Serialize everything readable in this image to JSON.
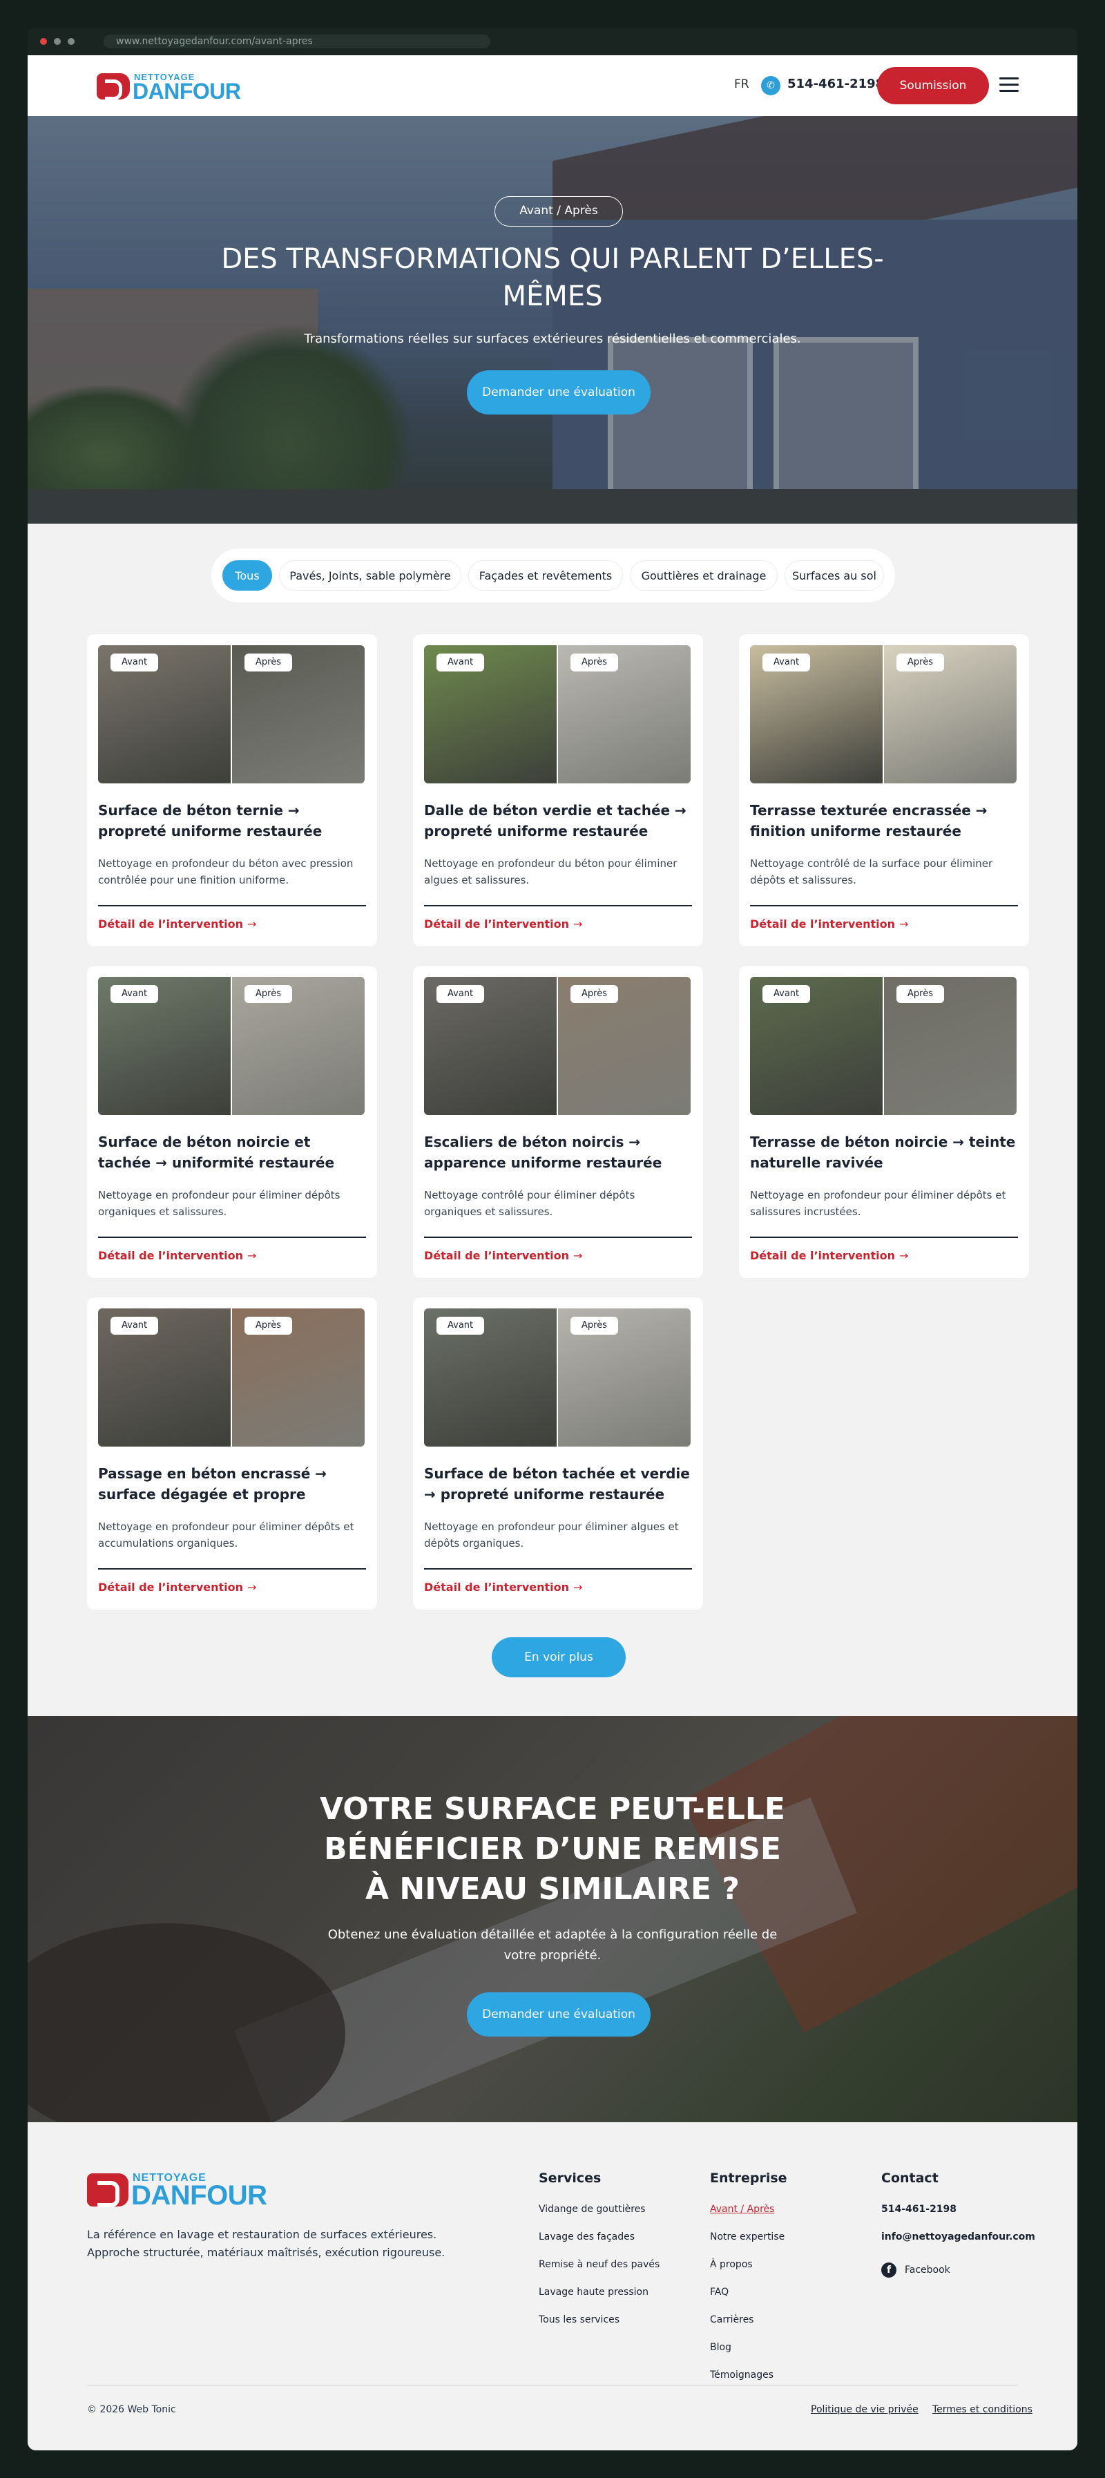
{
  "browser": {
    "url": "www.nettoyagedanfour.com/avant-apres"
  },
  "header": {
    "logo_small": "NETTOYAGE",
    "logo_big": "DANFOUR",
    "lang": "FR",
    "phone": "514-461-2198",
    "cta": "Soumission"
  },
  "hero": {
    "badge": "Avant / Après",
    "title": "DES TRANSFORMATIONS QUI PARLENT D’ELLES-MÊMES",
    "subtitle": "Transformations réelles sur surfaces extérieures résidentielles et commerciales.",
    "cta": "Demander une évaluation"
  },
  "filters": [
    "Tous",
    "Pavés, Joints, sable polymère",
    "Façades et revêtements",
    "Gouttières et drainage",
    "Surfaces au sol"
  ],
  "labels": {
    "before": "Avant",
    "after": "Après",
    "link": "Détail de l’intervention",
    "more": "En voir plus"
  },
  "cards": [
    {
      "title": "Surface de béton ternie → propreté uniforme restaurée",
      "desc": "Nettoyage en profondeur du béton avec pression contrôlée pour une finition uniforme."
    },
    {
      "title": "Dalle de béton verdie et tachée → propreté uniforme restaurée",
      "desc": "Nettoyage en profondeur du béton pour éliminer algues et salissures."
    },
    {
      "title": "Terrasse texturée encrassée → finition uniforme restaurée",
      "desc": "Nettoyage contrôlé de la surface pour éliminer dépôts et salissures."
    },
    {
      "title": "Surface de béton noircie et tachée → uniformité restaurée",
      "desc": "Nettoyage en profondeur pour éliminer dépôts organiques et salissures."
    },
    {
      "title": "Escaliers de béton noircis → apparence uniforme restaurée",
      "desc": "Nettoyage contrôlé pour éliminer dépôts organiques et salissures."
    },
    {
      "title": "Terrasse de béton noircie → teinte naturelle ravivée",
      "desc": "Nettoyage en profondeur pour éliminer dépôts et salissures incrustées."
    },
    {
      "title": "Passage en béton encrassé → surface dégagée et propre",
      "desc": "Nettoyage en profondeur pour éliminer dépôts et accumulations organiques."
    },
    {
      "title": "Surface de béton tachée et verdie → propreté uniforme restaurée",
      "desc": "Nettoyage en profondeur pour éliminer algues et dépôts organiques."
    }
  ],
  "cta_band": {
    "title": "VOTRE SURFACE PEUT-ELLE BÉNÉFICIER D’UNE REMISE À NIVEAU SIMILAIRE ?",
    "subtitle": "Obtenez une évaluation détaillée et adaptée à la configuration réelle de votre propriété.",
    "cta": "Demander une évaluation"
  },
  "footer": {
    "tagline": "La référence en lavage et restauration de surfaces extérieures. Approche structurée, matériaux maîtrisés, exécution rigoureuse.",
    "services": {
      "title": "Services",
      "items": [
        "Vidange de gouttières",
        "Lavage des façades",
        "Remise à neuf des pavés",
        "Lavage haute pression",
        "Tous les services"
      ]
    },
    "company": {
      "title": "Entreprise",
      "items": [
        "Avant / Après",
        "Notre expertise",
        "À propos",
        "FAQ",
        "Carrières",
        "Blog",
        "Témoignages"
      ]
    },
    "contact": {
      "title": "Contact",
      "phone": "514-461-2198",
      "email": "info@nettoyagedanfour.com",
      "facebook": "Facebook"
    },
    "copyright": "© 2026 Web Tonic",
    "privacy": "Politique de vie privée",
    "terms": "Termes et conditions"
  },
  "colors": {
    "brand_red": "#c8232f",
    "brand_blue": "#2ea6e2",
    "dark": "#1b2230"
  }
}
